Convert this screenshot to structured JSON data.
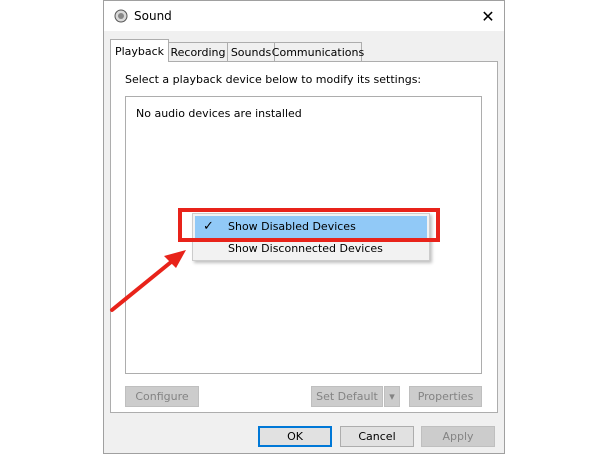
{
  "window": {
    "title": "Sound",
    "close_glyph": "✕"
  },
  "tabs": [
    {
      "label": "Playback",
      "active": true
    },
    {
      "label": "Recording",
      "active": false
    },
    {
      "label": "Sounds",
      "active": false
    },
    {
      "label": "Communications",
      "active": false
    }
  ],
  "panel": {
    "instruction": "Select a playback device below to modify its settings:",
    "empty_message": "No audio devices are installed"
  },
  "panel_buttons": {
    "configure": "Configure",
    "set_default": "Set Default",
    "set_default_arrow": "▾",
    "properties": "Properties"
  },
  "dialog_buttons": {
    "ok": "OK",
    "cancel": "Cancel",
    "apply": "Apply"
  },
  "context_menu": {
    "items": [
      {
        "label": "Show Disabled Devices",
        "checked": true,
        "check_glyph": "✓"
      },
      {
        "label": "Show Disconnected Devices",
        "checked": false
      }
    ]
  },
  "colors": {
    "menu_highlight": "#91c9f7",
    "annotation_red": "#e8231a",
    "default_button_border": "#0078d7"
  }
}
